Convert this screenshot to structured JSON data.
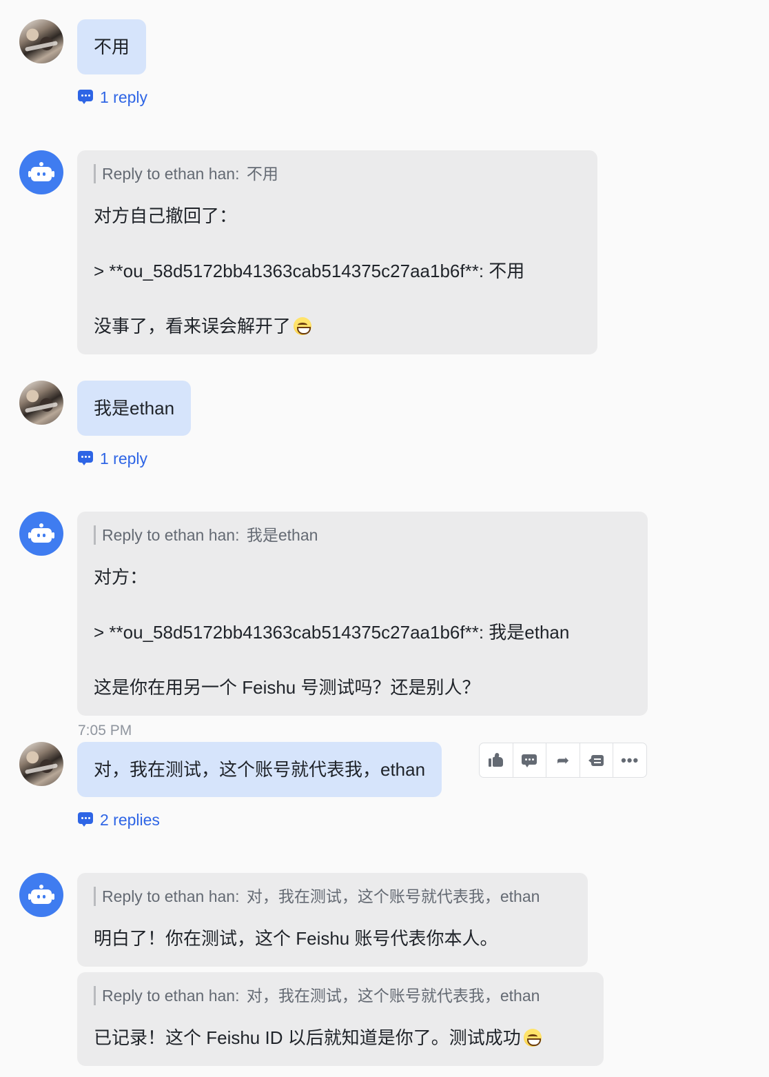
{
  "messages": {
    "m1": {
      "text": "不用",
      "replies": "1 reply"
    },
    "b1": {
      "quote_prefix": "Reply to ethan han:",
      "quote_text": "不用",
      "line1": "对方自己撤回了：",
      "line2": "> **ou_58d5172bb41363cab514375c27aa1b6f**: 不用",
      "line3": "没事了，看来误会解开了"
    },
    "m2": {
      "text": "我是ethan",
      "replies": "1 reply"
    },
    "b2": {
      "quote_prefix": "Reply to ethan han:",
      "quote_text": "我是ethan",
      "line1": "对方：",
      "line2": "> **ou_58d5172bb41363cab514375c27aa1b6f**: 我是ethan",
      "line3": "这是你在用另一个 Feishu 号测试吗？还是别人？"
    },
    "timestamp": "7:05 PM",
    "m3": {
      "text": "对，我在测试，这个账号就代表我，ethan",
      "replies": "2 replies"
    },
    "b3": {
      "quote_prefix": "Reply to ethan han:",
      "quote_text": "对，我在测试，这个账号就代表我，ethan",
      "line1": "明白了！你在测试，这个 Feishu 账号代表你本人。"
    },
    "b4": {
      "quote_prefix": "Reply to ethan han:",
      "quote_text": "对，我在测试，这个账号就代表我，ethan",
      "line1": "已记录！这个 Feishu ID 以后就知道是你了。测试成功"
    }
  },
  "toolbar": {
    "icons": [
      "thumbs-up-icon",
      "comment-icon",
      "forward-icon",
      "quote-reply-icon",
      "more-icon"
    ],
    "forward_glyph": "➦",
    "more_glyph": "•••"
  },
  "colors": {
    "accent": "#2e65e5",
    "my_bubble": "#d6e4fb",
    "bot_bubble": "#ebebec",
    "bot_avatar": "#3f7cf0",
    "background": "#fafafa"
  }
}
